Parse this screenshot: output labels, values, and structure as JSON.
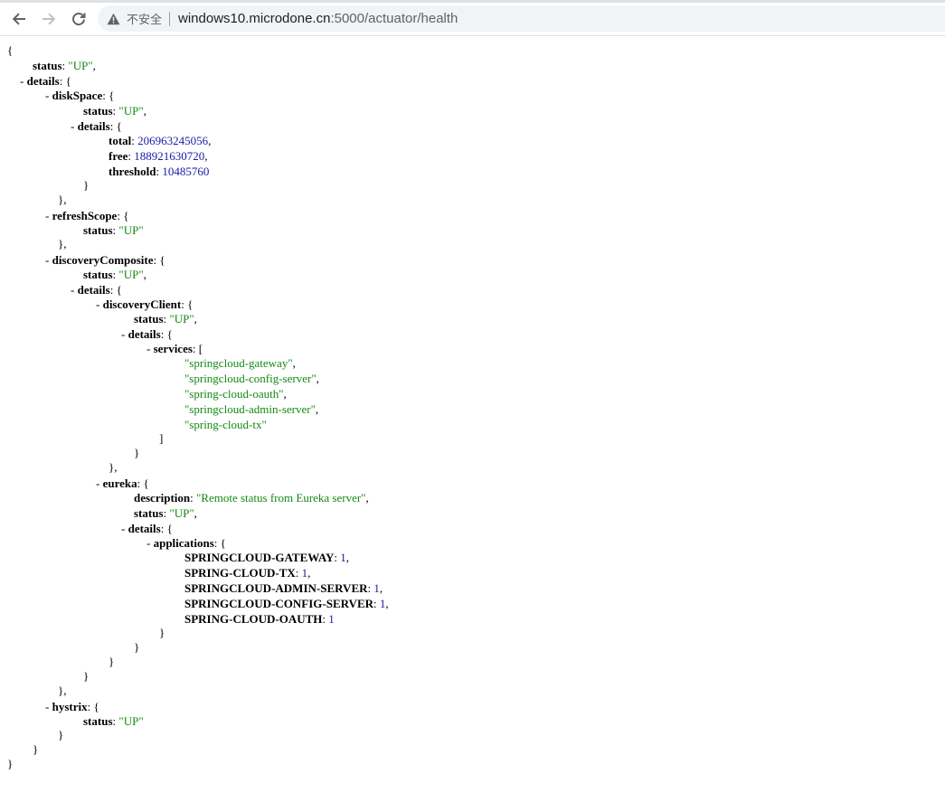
{
  "browser": {
    "security_label": "不安全",
    "url_host": "windows10.microdone.cn",
    "url_rest": ":5000/actuator/health"
  },
  "json": {
    "status": "\"UP\"",
    "details": {
      "diskSpace": {
        "status": "\"UP\"",
        "details": {
          "total": "206963245056",
          "free": "188921630720",
          "threshold": "10485760"
        }
      },
      "refreshScope": {
        "status": "\"UP\""
      },
      "discoveryComposite": {
        "status": "\"UP\"",
        "details": {
          "discoveryClient": {
            "status": "\"UP\"",
            "details": {
              "services": [
                "\"springcloud-gateway\"",
                "\"springcloud-config-server\"",
                "\"spring-cloud-oauth\"",
                "\"springcloud-admin-server\"",
                "\"spring-cloud-tx\""
              ]
            }
          },
          "eureka": {
            "description": "\"Remote status from Eureka server\"",
            "status": "\"UP\"",
            "details": {
              "applications": {
                "SPRINGCLOUD-GATEWAY": "1",
                "SPRING-CLOUD-TX": "1",
                "SPRINGCLOUD-ADMIN-SERVER": "1",
                "SPRINGCLOUD-CONFIG-SERVER": "1",
                "SPRING-CLOUD-OAUTH": "1"
              }
            }
          }
        }
      },
      "hystrix": {
        "status": "\"UP\""
      }
    }
  }
}
